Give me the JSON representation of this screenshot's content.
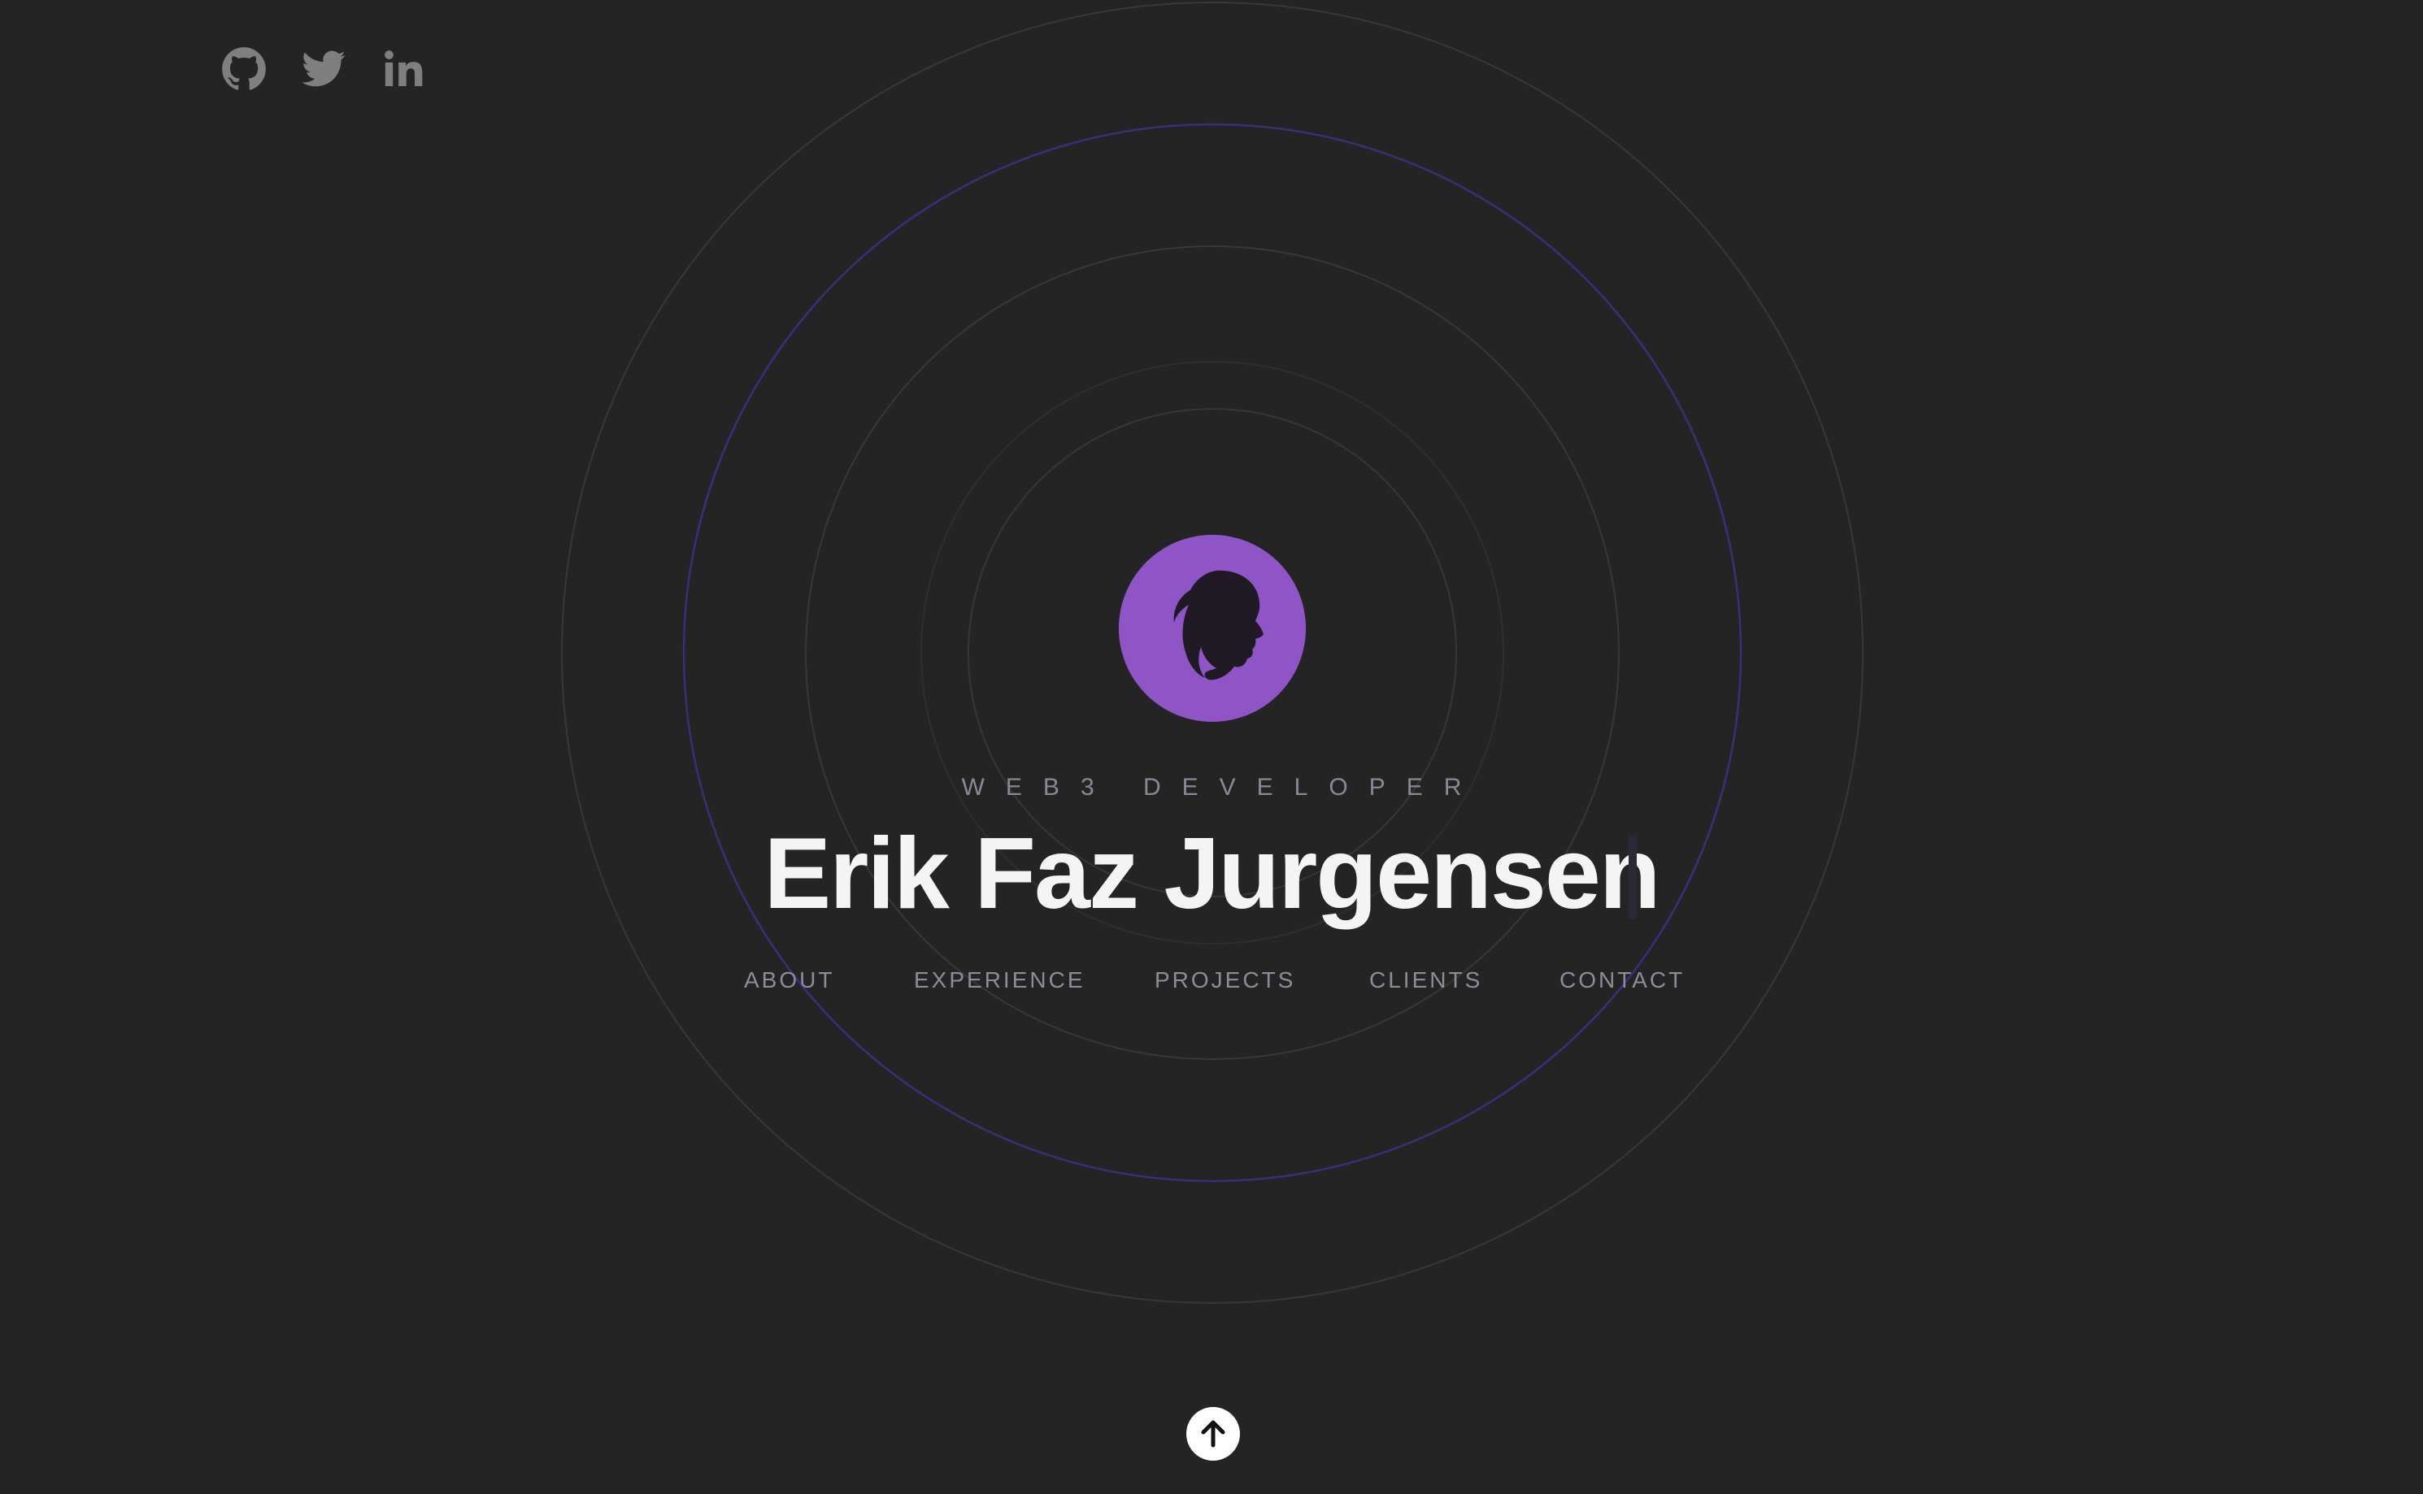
{
  "social": {
    "items": [
      {
        "name": "GitHub",
        "icon": "github-icon"
      },
      {
        "name": "Twitter",
        "icon": "twitter-icon"
      },
      {
        "name": "LinkedIn",
        "icon": "linkedin-icon"
      }
    ],
    "icon_color": "#7f7f7f"
  },
  "hero": {
    "avatar_icon": "profile-silhouette-icon",
    "avatar_color": "#8f55c7",
    "subtitle": "WEB3 DEVELOPER",
    "title": "Erik Faz Jurgensen"
  },
  "nav": {
    "items": [
      {
        "label": "ABOUT"
      },
      {
        "label": "EXPERIENCE"
      },
      {
        "label": "PROJECTS"
      },
      {
        "label": "CLIENTS"
      },
      {
        "label": "CONTACT"
      }
    ]
  },
  "scroll_top": {
    "icon": "arrow-up-icon"
  },
  "colors": {
    "background": "#242424",
    "ring": "#3a3a3a",
    "ring_accent": "#3a2f7a",
    "text": "#f4f4f4",
    "muted": "#8e8c99"
  }
}
